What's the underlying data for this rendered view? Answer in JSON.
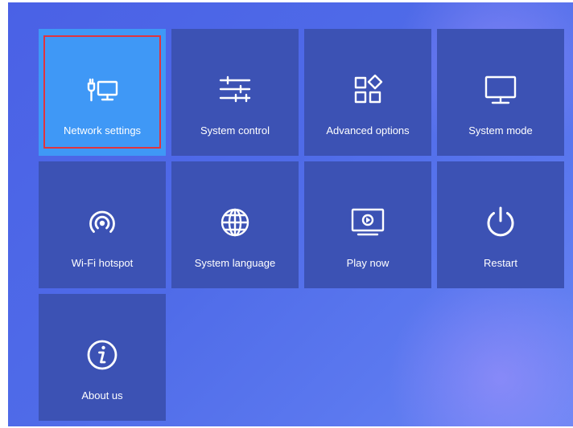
{
  "menu": {
    "tiles": [
      {
        "label": "Network settings",
        "icon": "network-icon",
        "selected": true
      },
      {
        "label": "System control",
        "icon": "sliders-icon",
        "selected": false
      },
      {
        "label": "Advanced options",
        "icon": "apps-icon",
        "selected": false
      },
      {
        "label": "System mode",
        "icon": "monitor-icon",
        "selected": false
      },
      {
        "label": "Wi-Fi hotspot",
        "icon": "hotspot-icon",
        "selected": false
      },
      {
        "label": "System language",
        "icon": "globe-icon",
        "selected": false
      },
      {
        "label": "Play now",
        "icon": "play-screen-icon",
        "selected": false
      },
      {
        "label": "Restart",
        "icon": "power-icon",
        "selected": false
      },
      {
        "label": "About us",
        "icon": "info-icon",
        "selected": false
      }
    ]
  },
  "colors": {
    "tile_background": "#3c52b4",
    "tile_selected_background": "#3f98f6",
    "focus_outline": "#e0343e",
    "screen_background": "#4f6be8"
  }
}
